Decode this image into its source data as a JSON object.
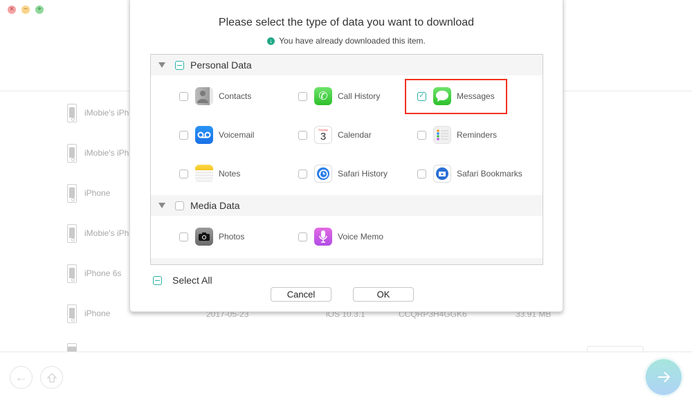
{
  "window": {
    "controls": [
      "close",
      "minimize",
      "maximize"
    ]
  },
  "background": {
    "devices": [
      {
        "name": "iMobie's iPh"
      },
      {
        "name": "iMobie's iPh"
      },
      {
        "name": "iPhone"
      },
      {
        "name": "iMobie's iPh"
      },
      {
        "name": "iPhone 6s"
      },
      {
        "name": "iPhone"
      }
    ],
    "last_row_details": {
      "date": "2017-05-23",
      "ios": "iOS 10.3.1",
      "serial": "CCQRP3H4GGK6",
      "size": "33.91 MB"
    }
  },
  "footer": {
    "back_icon": "arrow-left-icon",
    "home_icon": "home-icon",
    "next_icon": "arrow-right-icon"
  },
  "dialog": {
    "title": "Please select the type of data you want to download",
    "note": "You have already downloaded this item.",
    "categories": [
      {
        "label": "Personal Data",
        "state": "partial",
        "items": [
          {
            "label": "Contacts",
            "icon": "contacts-icon",
            "checked": false
          },
          {
            "label": "Call History",
            "icon": "phone-icon",
            "checked": false
          },
          {
            "label": "Messages",
            "icon": "messages-icon",
            "checked": true
          },
          {
            "label": "Voicemail",
            "icon": "voicemail-icon",
            "checked": false
          },
          {
            "label": "Calendar",
            "icon": "calendar-icon",
            "checked": false,
            "icon_text": "3",
            "icon_day": "Sunday"
          },
          {
            "label": "Reminders",
            "icon": "reminders-icon",
            "checked": false
          },
          {
            "label": "Notes",
            "icon": "notes-icon",
            "checked": false
          },
          {
            "label": "Safari History",
            "icon": "safari-history-icon",
            "checked": false
          },
          {
            "label": "Safari Bookmarks",
            "icon": "safari-bookmarks-icon",
            "checked": false
          }
        ]
      },
      {
        "label": "Media Data",
        "state": "unchecked",
        "items": [
          {
            "label": "Photos",
            "icon": "camera-icon",
            "checked": false
          },
          {
            "label": "Voice Memo",
            "icon": "microphone-icon",
            "checked": false
          }
        ]
      }
    ],
    "select_all_label": "Select All",
    "select_all_state": "partial",
    "cancel_label": "Cancel",
    "ok_label": "OK"
  },
  "colors": {
    "accent": "#2bb3a6",
    "highlight": "#f2301e",
    "download_badge": "#23a987"
  }
}
